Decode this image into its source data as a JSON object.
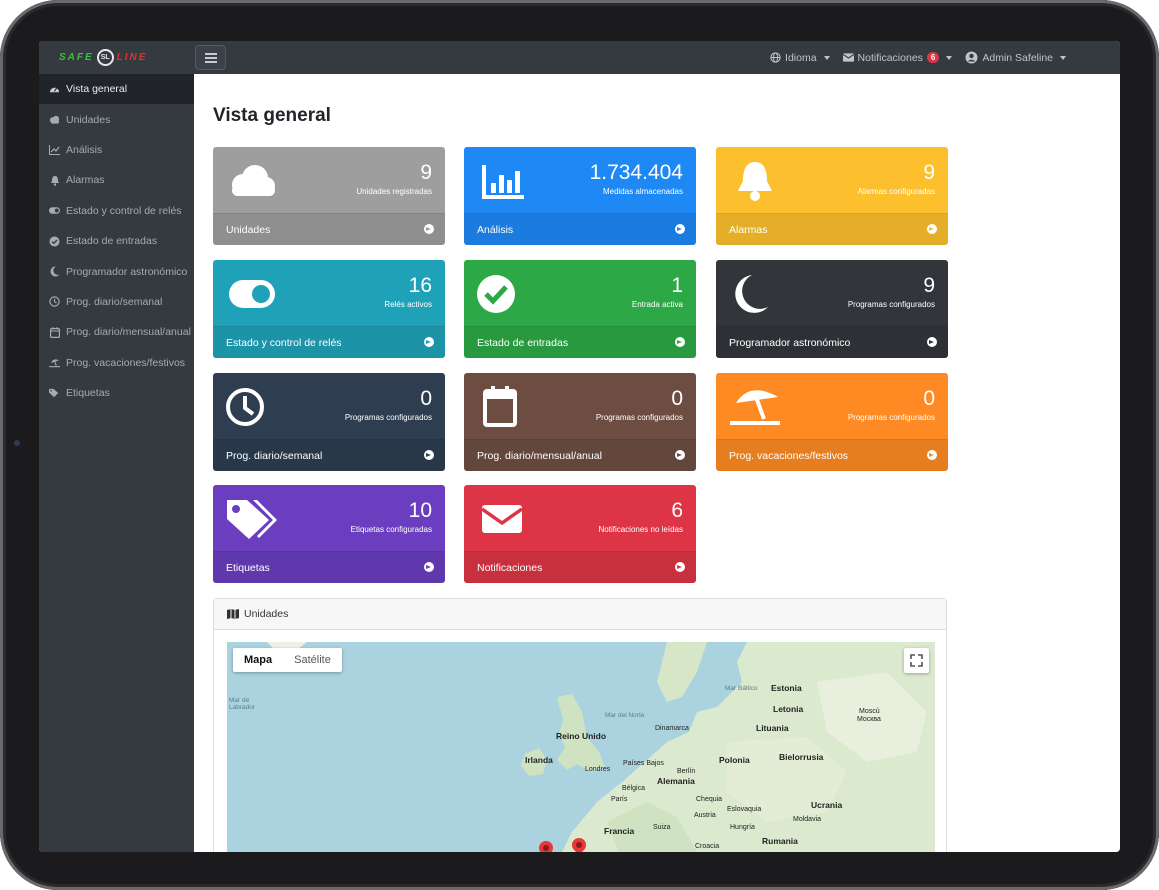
{
  "brand": {
    "left": "SAFE",
    "mark": "SL",
    "right": "LINE"
  },
  "navbar": {
    "language": "Idioma",
    "notifications": "Notificaciones",
    "notifications_count": "6",
    "user": "Admin Safeline"
  },
  "sidebar": {
    "items": [
      {
        "label": "Vista general",
        "icon": "dashboard-icon"
      },
      {
        "label": "Unidades",
        "icon": "cloud-icon"
      },
      {
        "label": "Análisis",
        "icon": "chart-icon"
      },
      {
        "label": "Alarmas",
        "icon": "bell-icon"
      },
      {
        "label": "Estado y control de relés",
        "icon": "toggle-icon"
      },
      {
        "label": "Estado de entradas",
        "icon": "check-circle-icon"
      },
      {
        "label": "Programador astronómico",
        "icon": "moon-icon"
      },
      {
        "label": "Prog. diario/semanal",
        "icon": "clock-icon"
      },
      {
        "label": "Prog. diario/mensual/anual",
        "icon": "calendar-icon"
      },
      {
        "label": "Prog. vacaciones/festivos",
        "icon": "umbrella-beach-icon"
      },
      {
        "label": "Etiquetas",
        "icon": "tags-icon"
      }
    ]
  },
  "page_title": "Vista general",
  "cards": [
    {
      "value": "9",
      "label": "Unidades registradas",
      "footer": "Unidades",
      "color": "#9e9e9e",
      "icon": "cloud-icon"
    },
    {
      "value": "1.734.404",
      "label": "Medidas almacenadas",
      "footer": "Análisis",
      "color": "#1e88f5",
      "icon": "chart-icon"
    },
    {
      "value": "9",
      "label": "Alarmas configuradas",
      "footer": "Alarmas",
      "color": "#fcc02e",
      "icon": "bell-icon"
    },
    {
      "value": "16",
      "label": "Relés activos",
      "footer": "Estado y control de relés",
      "color": "#1fa2b8",
      "icon": "toggle-icon"
    },
    {
      "value": "1",
      "label": "Entrada activa",
      "footer": "Estado de entradas",
      "color": "#2ca946",
      "icon": "check-circle-icon"
    },
    {
      "value": "9",
      "label": "Programas configurados",
      "footer": "Programador astronómico",
      "color": "#32363b",
      "icon": "moon-icon"
    },
    {
      "value": "0",
      "label": "Programas configurados",
      "footer": "Prog. diario/semanal",
      "color": "#2e3e50",
      "icon": "clock-icon"
    },
    {
      "value": "0",
      "label": "Programas configurados",
      "footer": "Prog. diario/mensual/anual",
      "color": "#6d4d42",
      "icon": "calendar-icon"
    },
    {
      "value": "0",
      "label": "Programas configurados",
      "footer": "Prog. vacaciones/festivos",
      "color": "#fd8a23",
      "icon": "umbrella-beach-icon"
    },
    {
      "value": "10",
      "label": "Etiquetas configuradas",
      "footer": "Etiquetas",
      "color": "#6a3ebf",
      "icon": "tags-icon"
    },
    {
      "value": "6",
      "label": "Notificaciones no leídas",
      "footer": "Notificaciones",
      "color": "#dd3545",
      "icon": "envelope-icon"
    }
  ],
  "map": {
    "panel_title": "Unidades",
    "type_map": "Mapa",
    "type_satellite": "Satélite",
    "labels": {
      "mar_labrador_1": "Mar de",
      "mar_labrador_2": "Labrador",
      "mar_norte": "Mar del Norte",
      "mar_baltico": "Mar Báltico",
      "estonia": "Estonia",
      "letonia": "Letonia",
      "lituania": "Lituania",
      "moscu_1": "Moscú",
      "moscu_2": "Москва",
      "reino_unido": "Reino Unido",
      "irlanda": "Irlanda",
      "dinamarca": "Dinamarca",
      "bielorrusia": "Bielorrusia",
      "paises_bajos": "Países Bajos",
      "berlin": "Berlín",
      "polonia": "Polonia",
      "londres": "Londres",
      "alemania": "Alemania",
      "belgica": "Bélgica",
      "paris": "París",
      "chequia": "Chequia",
      "ucrania": "Ucrania",
      "eslovaquia": "Eslovaquia",
      "austria": "Austria",
      "moldavia": "Moldavia",
      "francia": "Francia",
      "hungria": "Hungría",
      "suiza": "Suiza",
      "rumania": "Rumania",
      "croacia": "Croacia"
    }
  }
}
